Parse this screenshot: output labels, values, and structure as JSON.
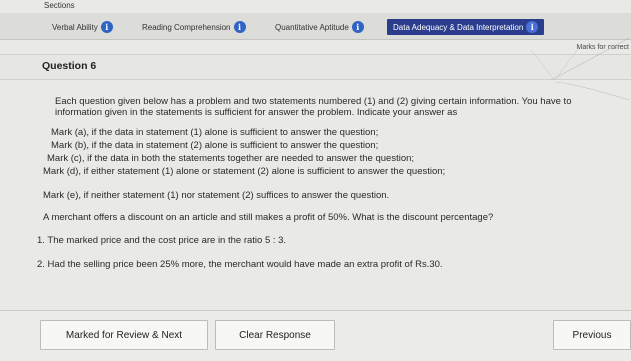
{
  "header": {
    "sections_label": "Sections"
  },
  "tabs": [
    {
      "label": "Verbal Ability",
      "active": false
    },
    {
      "label": "Reading Comprehension",
      "active": false
    },
    {
      "label": "Quantitative Aptitude",
      "active": false
    },
    {
      "label": "Data Adequacy & Data Interpretation",
      "active": true
    }
  ],
  "marks_label": "Marks for correct",
  "question": {
    "title": "Question 6",
    "instructions": [
      "Each question given below has a problem and two statements numbered (1) and (2) giving certain information. You have to",
      "information given in the statements is sufficient for answer the problem. Indicate your answer as"
    ],
    "options": [
      "Mark (a), if the data in statement (1) alone is sufficient to answer the question;",
      "Mark (b), if the data in statement (2) alone is sufficient to answer the question;",
      "Mark (c), if the data in both the statements together are needed to answer the question;",
      "Mark (d), if either statement (1) alone or statement (2) alone is sufficient to answer the question;",
      "Mark (e), if neither statement (1) nor statement (2) suffices to answer the question."
    ],
    "problem": "A merchant offers a discount on an article and still makes a profit of 50%. What is the discount percentage?",
    "statements": [
      "1. The marked price and the cost price are in the ratio 5 : 3.",
      "2. Had the selling price been 25% more, the merchant would have made an extra profit of Rs.30."
    ]
  },
  "footer": {
    "mark_review_label": "Marked for Review & Next",
    "clear_label": "Clear Response",
    "previous_label": "Previous"
  },
  "colors": {
    "active_tab": "#2b3e8d",
    "info_icon": "#2f63c4"
  }
}
